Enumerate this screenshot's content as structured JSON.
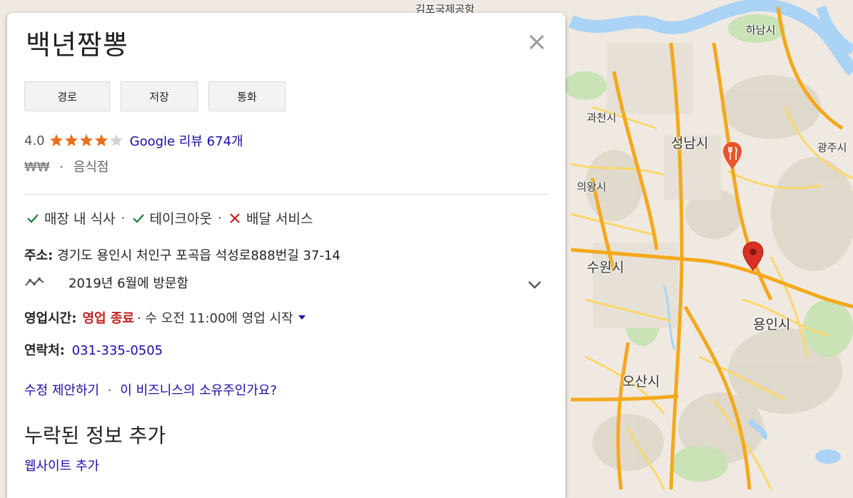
{
  "place": {
    "name": "백년짬뽕",
    "rating": "4.0",
    "stars_filled": 4,
    "stars_total": 5,
    "reviews_label": "Google 리뷰 674개",
    "price_level": "₩₩",
    "category": "음식점",
    "dot": "·"
  },
  "actions": {
    "directions": "경로",
    "save": "저장",
    "call": "통화"
  },
  "services": {
    "dine_in": "매장 내 식사",
    "takeout": "테이크아웃",
    "delivery": "배달 서비스",
    "dine_in_available": true,
    "takeout_available": true,
    "delivery_available": false
  },
  "address": {
    "label": "주소:",
    "value": "경기도 용인시 처인구 포곡읍 석성로888번길 37-14"
  },
  "visit": {
    "text": "2019년 6월에 방문함"
  },
  "hours": {
    "label": "영업시간:",
    "status": "영업 종료",
    "next": "· 수 오전 11:00에 영업 시작"
  },
  "contact": {
    "label": "연락처:",
    "phone": "031-335-0505"
  },
  "links": {
    "suggest_edit": "수정 제안하기",
    "owner": "이 비즈니스의 소유주인가요?",
    "dot": "·"
  },
  "missing": {
    "heading": "누락된 정보 추가",
    "add_website": "웹사이트 추가"
  },
  "map": {
    "labels": {
      "gimpo": "김포국제공항",
      "hanam": "하남시",
      "gwacheon": "과천시",
      "seongnam": "성남시",
      "gwangju": "광주시",
      "uiwang": "의왕시",
      "suwon": "수원시",
      "yongin": "용인시",
      "osan": "오산시"
    },
    "colors": {
      "highway": "#f4a81c",
      "road": "#fbd76a",
      "water": "#aad3f5",
      "park": "#c9e2b6",
      "pin": "#d93025"
    }
  },
  "colors": {
    "link": "#1a0dab",
    "star": "#e7711b",
    "closed": "#c5221f",
    "check": "#188038"
  }
}
